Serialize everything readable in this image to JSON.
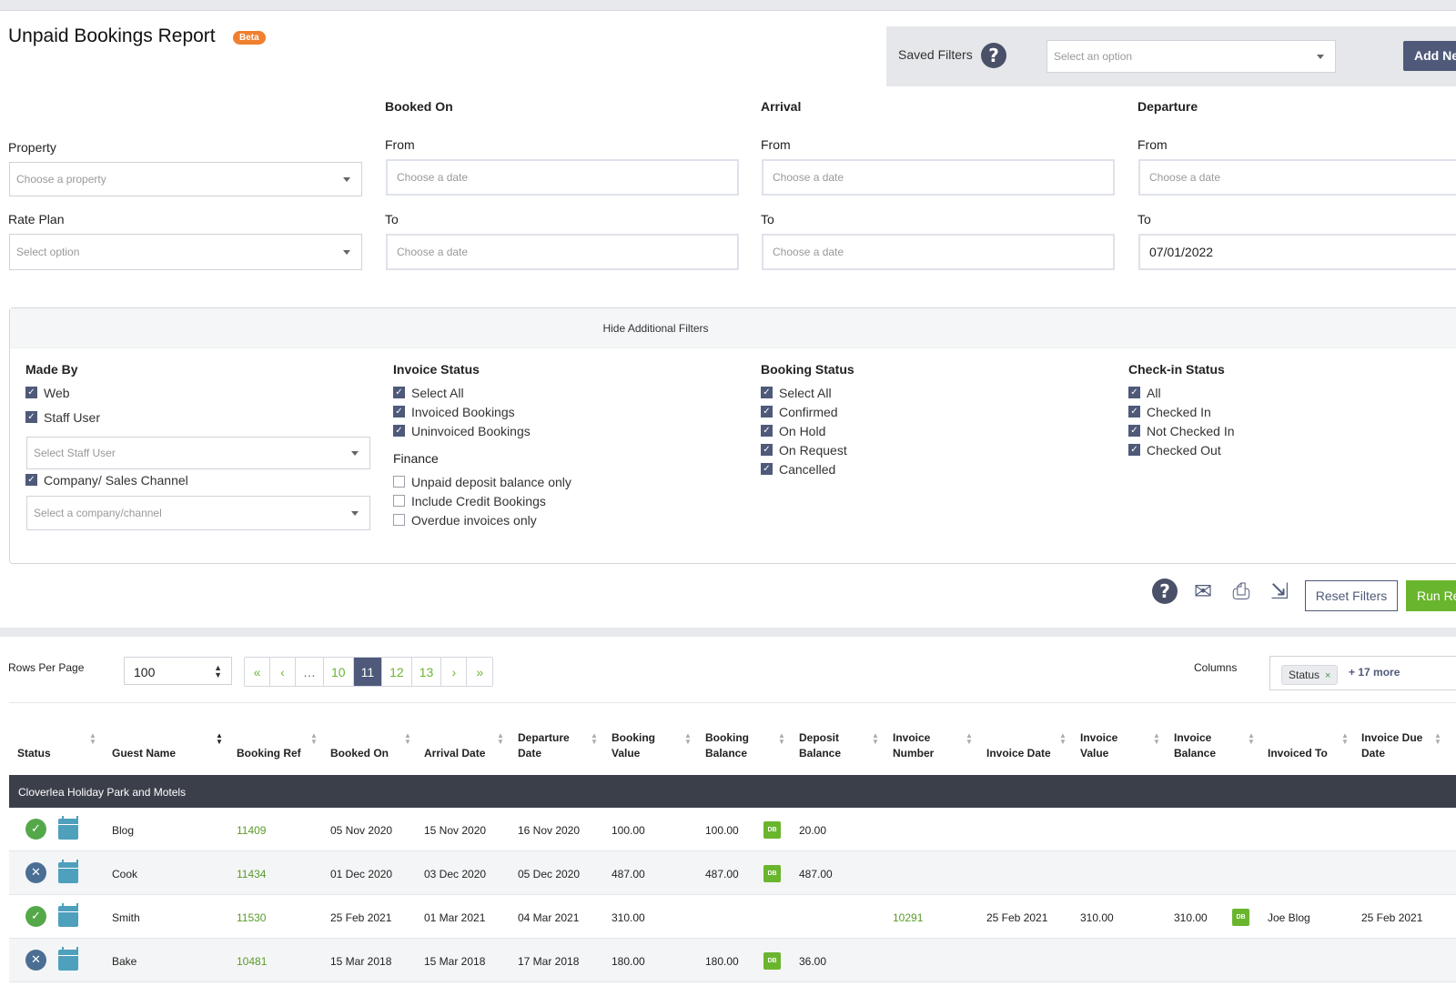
{
  "title": "Unpaid Bookings Report",
  "beta": "Beta",
  "saved_filters": {
    "label": "Saved Filters",
    "placeholder": "Select an option",
    "add_button": "Add Ne"
  },
  "filters": {
    "property_label": "Property",
    "property_placeholder": "Choose a property",
    "rateplan_label": "Rate Plan",
    "rateplan_placeholder": "Select option",
    "booked_on": "Booked On",
    "arrival": "Arrival",
    "departure": "Departure",
    "from": "From",
    "to": "To",
    "date_placeholder": "Choose a date",
    "departure_to_value": "07/01/2022"
  },
  "additional": {
    "toggle": "Hide Additional Filters",
    "made_by": {
      "title": "Made By",
      "web": "Web",
      "staff": "Staff User",
      "staff_placeholder": "Select Staff User",
      "company": "Company/ Sales Channel",
      "company_placeholder": "Select a company/channel"
    },
    "invoice_status": {
      "title": "Invoice Status",
      "items": [
        "Select All",
        "Invoiced Bookings",
        "Uninvoiced Bookings"
      ]
    },
    "finance": {
      "title": "Finance",
      "items": [
        "Unpaid deposit balance only",
        "Include Credit Bookings",
        "Overdue invoices only"
      ]
    },
    "booking_status": {
      "title": "Booking Status",
      "items": [
        "Select All",
        "Confirmed",
        "On Hold",
        "On Request",
        "Cancelled"
      ]
    },
    "checkin_status": {
      "title": "Check-in Status",
      "items": [
        "All",
        "Checked In",
        "Not Checked In",
        "Checked Out"
      ]
    }
  },
  "actions": {
    "reset": "Reset Filters",
    "run": "Run Re"
  },
  "pagination": {
    "rows_label": "Rows Per Page",
    "rows_value": "100",
    "first": "«",
    "prev": "‹",
    "dots": "…",
    "pages": [
      "10",
      "11",
      "12",
      "13"
    ],
    "next": "›",
    "last": "»"
  },
  "columns": {
    "label": "Columns",
    "chip": "Status",
    "chip_x": "×",
    "more": "+ 17 more"
  },
  "table": {
    "headers": {
      "status": "Status",
      "guest": "Guest Name",
      "ref": "Booking Ref",
      "booked": "Booked On",
      "arrival": "Arrival Date",
      "departure": "Departure Date",
      "bvalue": "Booking Value",
      "bbalance": "Booking Balance",
      "deposit": "Deposit Balance",
      "invnum": "Invoice Number",
      "invdate": "Invoice Date",
      "invvalue": "Invoice Value",
      "invbalance": "Invoice Balance",
      "invto": "Invoiced To",
      "invdue": "Invoice Due Date"
    },
    "group": "Cloverlea Holiday Park and Motels",
    "db_badge": "DB",
    "rows": [
      {
        "guest": "Blog",
        "ref": "11409",
        "booked": "05 Nov 2020",
        "arrival": "15 Nov 2020",
        "departure": "16 Nov 2020",
        "bvalue": "100.00",
        "bbalance": "100.00",
        "deposit": "20.00",
        "invnum": "",
        "invdate": "",
        "invvalue": "",
        "invbalance": "",
        "invto": "",
        "invdue": ""
      },
      {
        "guest": "Cook",
        "ref": "11434",
        "booked": "01 Dec 2020",
        "arrival": "03 Dec 2020",
        "departure": "05 Dec 2020",
        "bvalue": "487.00",
        "bbalance": "487.00",
        "deposit": "487.00",
        "invnum": "",
        "invdate": "",
        "invvalue": "",
        "invbalance": "",
        "invto": "",
        "invdue": ""
      },
      {
        "guest": "Smith",
        "ref": "11530",
        "booked": "25 Feb 2021",
        "arrival": "01 Mar 2021",
        "departure": "04 Mar 2021",
        "bvalue": "310.00",
        "bbalance": "",
        "deposit": "",
        "invnum": "10291",
        "invdate": "25 Feb 2021",
        "invvalue": "310.00",
        "invbalance": "310.00",
        "invto": "Joe Blog",
        "invdue": "25 Feb 2021"
      },
      {
        "guest": "Bake",
        "ref": "10481",
        "booked": "15 Mar 2018",
        "arrival": "15 Mar 2018",
        "departure": "17 Mar 2018",
        "bvalue": "180.00",
        "bbalance": "180.00",
        "deposit": "36.00",
        "invnum": "",
        "invdate": "",
        "invvalue": "",
        "invbalance": "",
        "invto": "",
        "invdue": ""
      }
    ]
  }
}
